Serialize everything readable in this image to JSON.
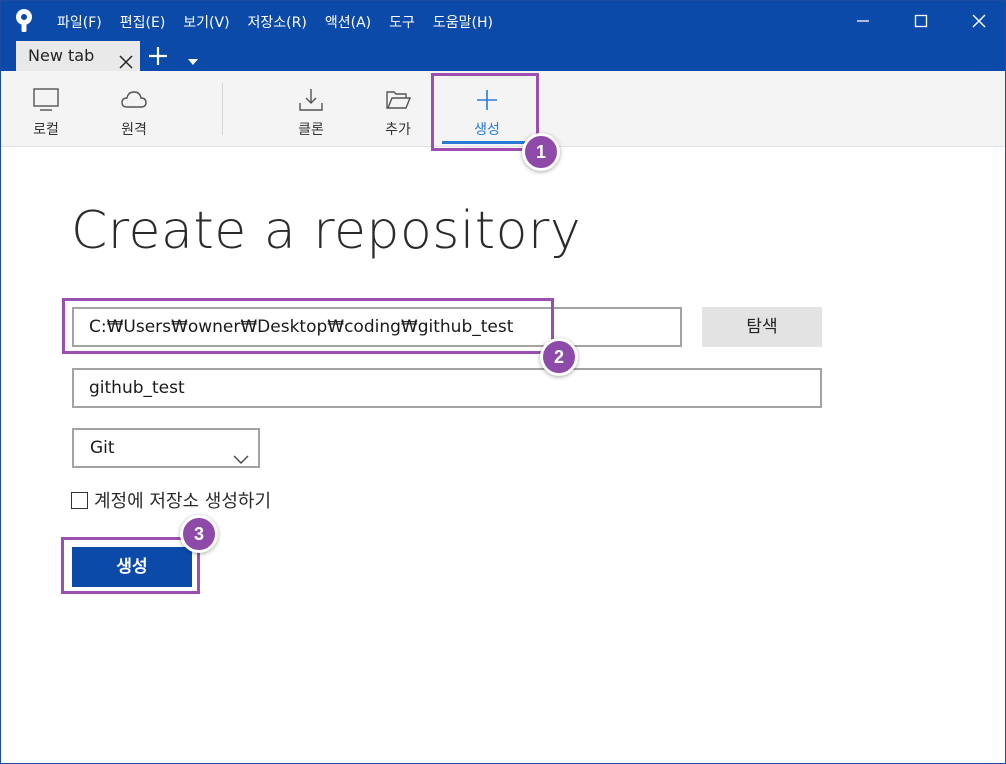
{
  "menu": [
    "파일(F)",
    "편집(E)",
    "보기(V)",
    "저장소(R)",
    "액션(A)",
    "도구",
    "도움말(H)"
  ],
  "tab": {
    "label": "New tab"
  },
  "toolbar": {
    "local": "로컬",
    "remote": "원격",
    "clone": "클론",
    "add": "추가",
    "create": "생성"
  },
  "page": {
    "title": "Create a repository",
    "path_value": "C:₩Users₩owner₩Desktop₩coding₩github_test",
    "browse_label": "탐색",
    "name_value": "github_test",
    "vcs_selected": "Git",
    "checkbox_label": "계정에 저장소 생성하기",
    "create_button": "생성"
  },
  "annotations": {
    "badge1": "1",
    "badge2": "2",
    "badge3": "3"
  },
  "colors": {
    "accent": "#0b4aa8",
    "highlight": "#9b4fb0",
    "active_tool": "#2a7bd6"
  }
}
